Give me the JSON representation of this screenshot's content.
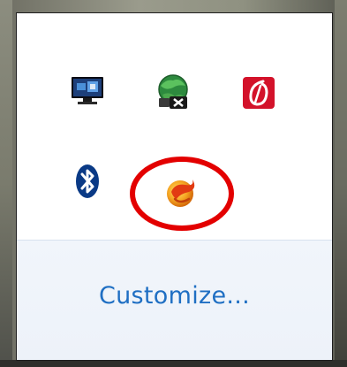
{
  "tray_overflow": {
    "icons": [
      {
        "name": "display-network-icon"
      },
      {
        "name": "network-globe-icon"
      },
      {
        "name": "red-app-icon"
      },
      {
        "name": "bluetooth-icon"
      },
      {
        "name": "orange-swirl-app-icon"
      }
    ],
    "customize_label": "Customize...",
    "highlight_color": "#e30000",
    "link_color": "#1f6fc3"
  }
}
